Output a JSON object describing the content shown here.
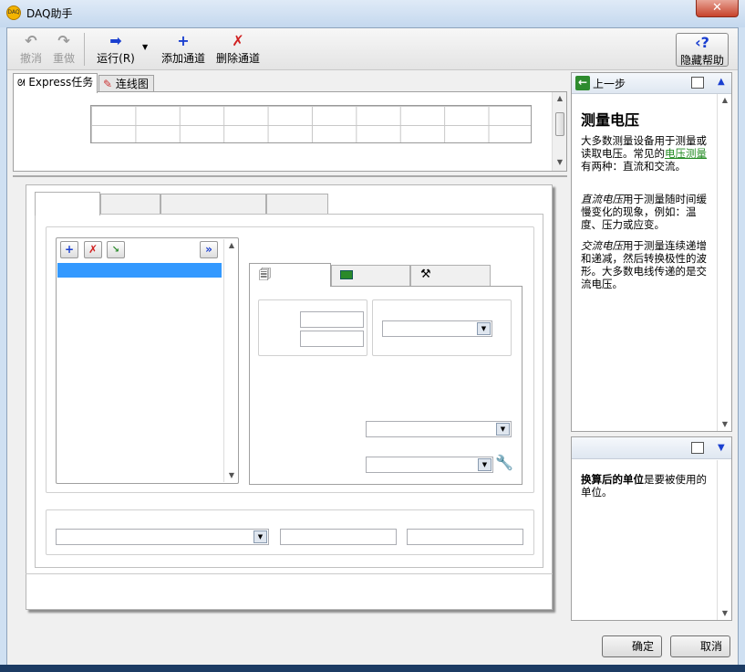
{
  "window": {
    "title": "DAQ助手",
    "close_glyph": "✕"
  },
  "toolbar": {
    "undo": "撤消",
    "redo": "重做",
    "run": "运行(R)",
    "add_channel": "添加通道",
    "delete_channel": "删除通道",
    "hide_help": "隐藏帮助"
  },
  "tabs": {
    "express": "Express任务",
    "wiring": "连线图"
  },
  "help": {
    "back": "上一步",
    "title": "测量电压",
    "p1a": "大多数测量设备用于测量或读取电压。常见的",
    "p1link": "电压测量",
    "p1b": "有两种：直流和交流。",
    "p2term": "直流电压",
    "p2": "用于测量随时间缓慢变化的现象，例如：温度、压力或应变。",
    "p3term": "交流电压",
    "p3": "用于测量连续递增和递减，然后转换极性的波形。大多数电线传递的是交流电压。",
    "term": "换算后的单位",
    "term_desc": "是要被使用的单位。"
  },
  "buttons": {
    "ok": "确定",
    "cancel": "取消"
  },
  "colors": {
    "selection": "#3399ff",
    "accent": "#1a3fd0",
    "delete": "#d02020"
  }
}
